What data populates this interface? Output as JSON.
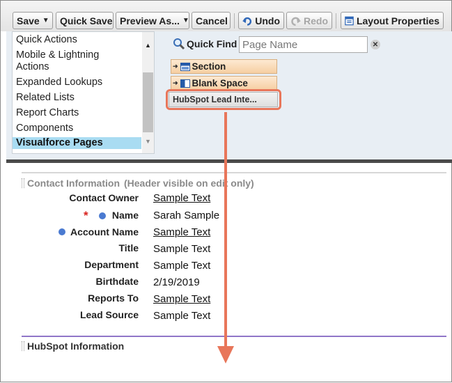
{
  "toolbar": {
    "save": "Save",
    "quick_save": "Quick Save",
    "preview_as": "Preview As...",
    "cancel": "Cancel",
    "undo": "Undo",
    "redo": "Redo",
    "layout_properties": "Layout Properties"
  },
  "palette": {
    "categories": [
      "Quick Actions",
      "Mobile & Lightning",
      "Actions",
      "Expanded Lookups",
      "Related Lists",
      "Report Charts",
      "Components",
      "Visualforce Pages"
    ],
    "selected_category": "Visualforce Pages",
    "quick_find": {
      "label": "Quick Find",
      "placeholder": "Page Name",
      "value": ""
    },
    "items": [
      "Section",
      "Blank Space"
    ],
    "highlighted_item": "HubSpot Lead Inte..."
  },
  "layout": {
    "contact_section": {
      "title": "Contact Information",
      "note": "(Header visible on edit only)"
    },
    "fields": [
      {
        "label": "Contact Owner",
        "value": "Sample Text"
      },
      {
        "label": "Name",
        "value": "Sarah Sample"
      },
      {
        "label": "Account Name",
        "value": "Sample Text"
      },
      {
        "label": "Title",
        "value": "Sample Text"
      },
      {
        "label": "Department",
        "value": "Sample Text"
      },
      {
        "label": "Birthdate",
        "value": "2/19/2019"
      },
      {
        "label": "Reports To",
        "value": "Sample Text"
      },
      {
        "label": "Lead Source",
        "value": "Sample Text"
      }
    ],
    "hubspot_section": {
      "title": "HubSpot Information"
    }
  },
  "colors": {
    "highlight_outline": "#e8765a",
    "arrow": "#e8765a",
    "selected_category_bg": "#a9dcf2",
    "required_star": "#d8221e",
    "blue_dot": "#4a7ad1",
    "hubspot_rule": "#9076c8"
  },
  "icons": {
    "undo": "undo-arrow-icon",
    "redo": "redo-arrow-icon",
    "layout_properties": "layout-properties-icon",
    "quick_find": "magnifier-icon",
    "clear": "clear-x-icon",
    "section": "section-icon",
    "blank_space": "blank-space-icon"
  }
}
